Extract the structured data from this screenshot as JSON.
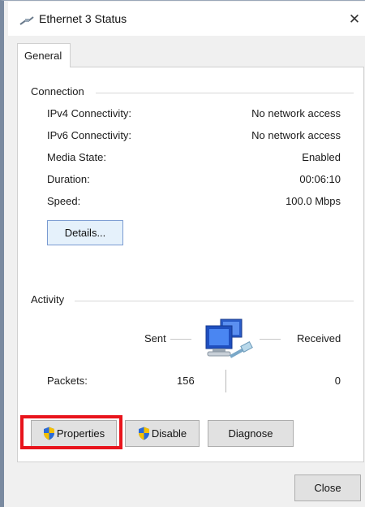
{
  "window": {
    "title": "Ethernet 3 Status",
    "close_glyph": "✕"
  },
  "tabs": [
    {
      "label": "General"
    }
  ],
  "connection": {
    "section_label": "Connection",
    "rows": [
      {
        "label": "IPv4 Connectivity:",
        "value": "No network access"
      },
      {
        "label": "IPv6 Connectivity:",
        "value": "No network access"
      },
      {
        "label": "Media State:",
        "value": "Enabled"
      },
      {
        "label": "Duration:",
        "value": "00:06:10"
      },
      {
        "label": "Speed:",
        "value": "100.0 Mbps"
      }
    ],
    "details_button": "Details..."
  },
  "activity": {
    "section_label": "Activity",
    "sent_label": "Sent",
    "received_label": "Received",
    "packets_label": "Packets:",
    "packets_sent": "156",
    "packets_received": "0",
    "icon": "network-computers-icon"
  },
  "buttons": {
    "properties": "Properties",
    "disable": "Disable",
    "diagnose": "Diagnose",
    "close": "Close"
  },
  "colors": {
    "highlight": "#e8141c",
    "shield_blue": "#2b6bd6",
    "shield_yellow": "#f5c000"
  }
}
